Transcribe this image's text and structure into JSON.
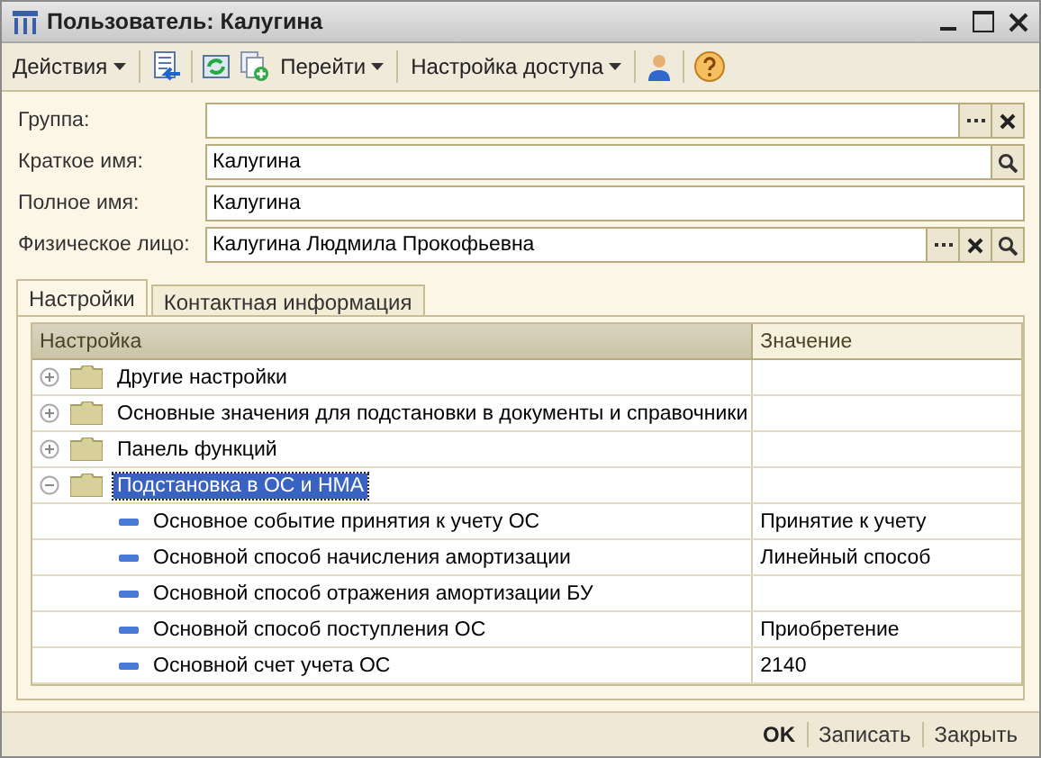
{
  "window": {
    "title": "Пользователь: Калугина"
  },
  "toolbar": [
    {
      "kind": "menu",
      "label": "Действия"
    },
    {
      "kind": "separator"
    },
    {
      "kind": "icon"
    },
    {
      "kind": "separator"
    },
    {
      "kind": "icon"
    },
    {
      "kind": "icon"
    },
    {
      "kind": "menu",
      "label": "Перейти"
    },
    {
      "kind": "separator"
    },
    {
      "kind": "menu",
      "label": "Настройка доступа"
    },
    {
      "kind": "separator"
    },
    {
      "kind": "icon"
    },
    {
      "kind": "separator"
    },
    {
      "kind": "icon"
    }
  ],
  "fields": [
    {
      "label": "Группа:",
      "choose": true,
      "clear": true
    },
    {
      "label": "Краткое имя:",
      "value": "Калугина",
      "search": true
    },
    {
      "label": "Полное имя:",
      "value": "Калугина"
    },
    {
      "label": "Физическое лицо:",
      "value": "Калугина Людмила Прокофьевна",
      "choose": true,
      "clear": true,
      "search": true
    }
  ],
  "tabs": [
    {
      "label": "Настройки",
      "selected": true
    },
    {
      "label": "Контактная информация",
      "selected": false
    }
  ],
  "table": {
    "columns": [
      "Настройка",
      "Значение"
    ],
    "rows": [
      {
        "kind": "group",
        "name": "Другие настройки",
        "expanded": false,
        "selected": false
      },
      {
        "kind": "group",
        "name": "Основные значения для подстановки в документы и справочники",
        "expanded": false,
        "selected": false
      },
      {
        "kind": "group",
        "name": "Панель функций",
        "expanded": false,
        "selected": false
      },
      {
        "kind": "group",
        "name": "Подстановка в ОС и НМА",
        "expanded": true,
        "selected": true,
        "children": [
          {
            "kind": "setting",
            "name": "Основное событие принятия к учету ОС",
            "value": "Принятие к учету",
            "selected": false
          },
          {
            "kind": "setting",
            "name": "Основной способ начисления амортизации",
            "value": "Линейный способ",
            "selected": false
          },
          {
            "kind": "setting",
            "name": "Основной способ отражения амортизации БУ",
            "selected": false
          },
          {
            "kind": "setting",
            "name": "Основной способ поступления ОС",
            "value": "Приобретение",
            "selected": false
          },
          {
            "kind": "setting",
            "name": "Основной счет учета ОС",
            "value": "2140",
            "selected": false
          }
        ]
      }
    ]
  },
  "buttons": [
    {
      "label": "OK",
      "default": true
    },
    {
      "label": "Записать",
      "default": false
    },
    {
      "label": "Закрыть",
      "default": false
    }
  ]
}
